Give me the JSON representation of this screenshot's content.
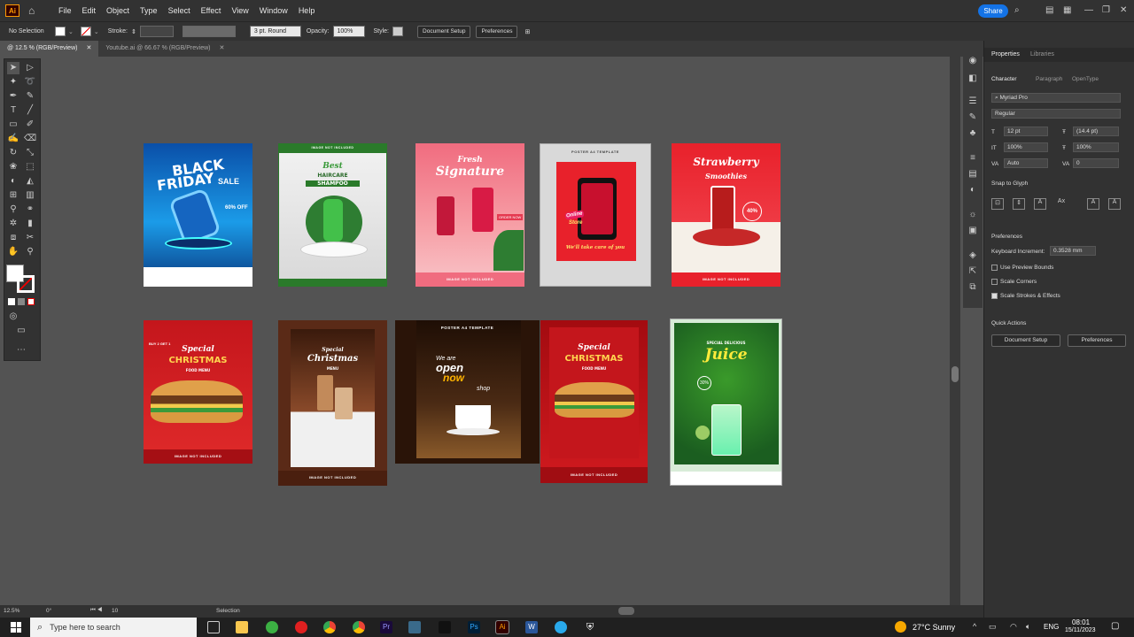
{
  "menubar": {
    "app_logo": "Ai",
    "items": [
      "File",
      "Edit",
      "Object",
      "Type",
      "Select",
      "Effect",
      "View",
      "Window",
      "Help"
    ],
    "share": "Share"
  },
  "control": {
    "selection": "No Selection",
    "stroke_label": "Stroke:",
    "brush": "3 pt. Round",
    "opacity_label": "Opacity:",
    "opacity": "100%",
    "style_label": "Style:",
    "doc_setup": "Document Setup",
    "prefs": "Preferences"
  },
  "tabs": [
    {
      "label": "@ 12.5 % (RGB/Preview)"
    },
    {
      "label": "Youtube.ai @ 66.67 % (RGB/Preview)"
    }
  ],
  "posters": [
    {
      "title1": "BLACK",
      "title2": "FRIDAY",
      "title3": "SALE",
      "sub": "60% OFF"
    },
    {
      "title1": "Best",
      "title2": "HAIRCARE",
      "title3": "SHAMPOO",
      "top": "IMAGE NOT INCLUDED"
    },
    {
      "title1": "Fresh",
      "title2": "Signature",
      "price": "ORDER NOW",
      "footer": "IMAGE NOT INCLUDED"
    },
    {
      "top": "POSTER A4 TEMPLATE",
      "title1": "Online",
      "title2": "Store",
      "sub": "We'll take care of you"
    },
    {
      "title1": "Strawberry",
      "title2": "Smoothies",
      "badge": "40%",
      "footer": "IMAGE NOT INCLUDED"
    },
    {
      "title1": "Special",
      "title2": "CHRISTMAS",
      "sub": "FOOD MENU",
      "buy": "BUY 2 GET 1",
      "footer": "IMAGE NOT INCLUDED"
    },
    {
      "title1": "Special",
      "title2": "Christmas",
      "sub": "MENU",
      "footer": "IMAGE NOT INCLUDED"
    },
    {
      "top": "POSTER A4 TEMPLATE",
      "title1": "We are",
      "title2": "open",
      "title3": "now",
      "shop": "shop"
    },
    {
      "title1": "Special",
      "title2": "CHRISTMAS",
      "sub": "FOOD MENU",
      "footer": "IMAGE NOT INCLUDED"
    },
    {
      "title1": "Juice",
      "sub": "SPECIAL DELICIOUS",
      "badge": "30%"
    }
  ],
  "panel": {
    "tabs": [
      "Properties",
      "Libraries"
    ],
    "subtabs": [
      "Character",
      "Paragraph",
      "OpenType"
    ],
    "font": "Myriad Pro",
    "style": "Regular",
    "size": "12 pt",
    "leading": "(14.4 pt)",
    "vscale": "100%",
    "hscale": "100%",
    "kerning": "Auto",
    "tracking": "0",
    "snap": "Snap to Glyph",
    "prefs_title": "Preferences",
    "kb_label": "Keyboard Increment:",
    "kb_value": "0.3528 mm",
    "check1": "Use Preview Bounds",
    "check2": "Scale Corners",
    "check3": "Scale Strokes & Effects",
    "quick": "Quick Actions",
    "doc_setup": "Document Setup",
    "prefs": "Preferences"
  },
  "status": {
    "zoom": "12.5%",
    "angle": "0°",
    "artboard": "10",
    "mode": "Selection"
  },
  "taskbar": {
    "search": "Type here to search",
    "weather": "27°C  Sunny",
    "lang": "ENG",
    "time": "08:01",
    "date": "15/11/2023"
  },
  "colors": {
    "accent": "#1473e6",
    "ai": "#ff9a00",
    "canvas": "#535353"
  }
}
